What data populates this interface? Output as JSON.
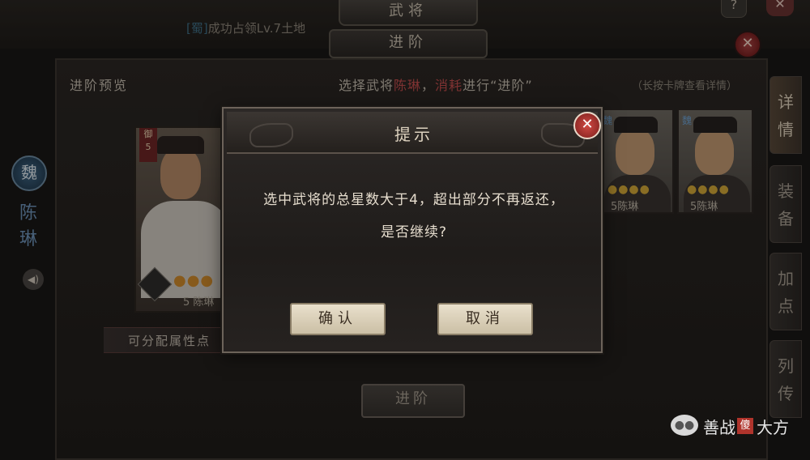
{
  "header": {
    "tab_generals": "武将",
    "tab_advance": "进阶",
    "news_tag": "[蜀]",
    "news_text": "成功占领Lv.7土地",
    "help": "?",
    "close": "✕"
  },
  "preview": {
    "title": "进阶预览",
    "rank_label": "御",
    "rank_level": "5",
    "stars": "●●●",
    "name": "5 陈琳",
    "attr_label": "可分配属性点"
  },
  "select_hint": {
    "prefix": "选择武将",
    "name": "陈琳",
    "sep": "，",
    "consume": "消耗",
    "suffix": "进行“进阶”",
    "long_press": "（长按卡牌查看详情）"
  },
  "side": {
    "kingdom": "魏",
    "name": "陈琳",
    "speaker": "◀)"
  },
  "cards": [
    {
      "kingdom": "魏",
      "stars": "●●●●",
      "name": "5陈琳"
    },
    {
      "kingdom": "魏",
      "stars": "●●●●",
      "name": "5陈琳"
    }
  ],
  "side_tabs": [
    "详情",
    "装备",
    "加点",
    "列传"
  ],
  "advance_button": "进阶",
  "dialog": {
    "title": "提示",
    "close": "✕",
    "message_line1": "选中武将的总星数大于4，超出部分不再返还，",
    "message_line2": "是否继续?",
    "confirm": "确认",
    "cancel": "取消"
  },
  "watermark": {
    "icon": "wechat-icon",
    "text": "善战",
    "stamp": "傻",
    "text2": "大方"
  }
}
